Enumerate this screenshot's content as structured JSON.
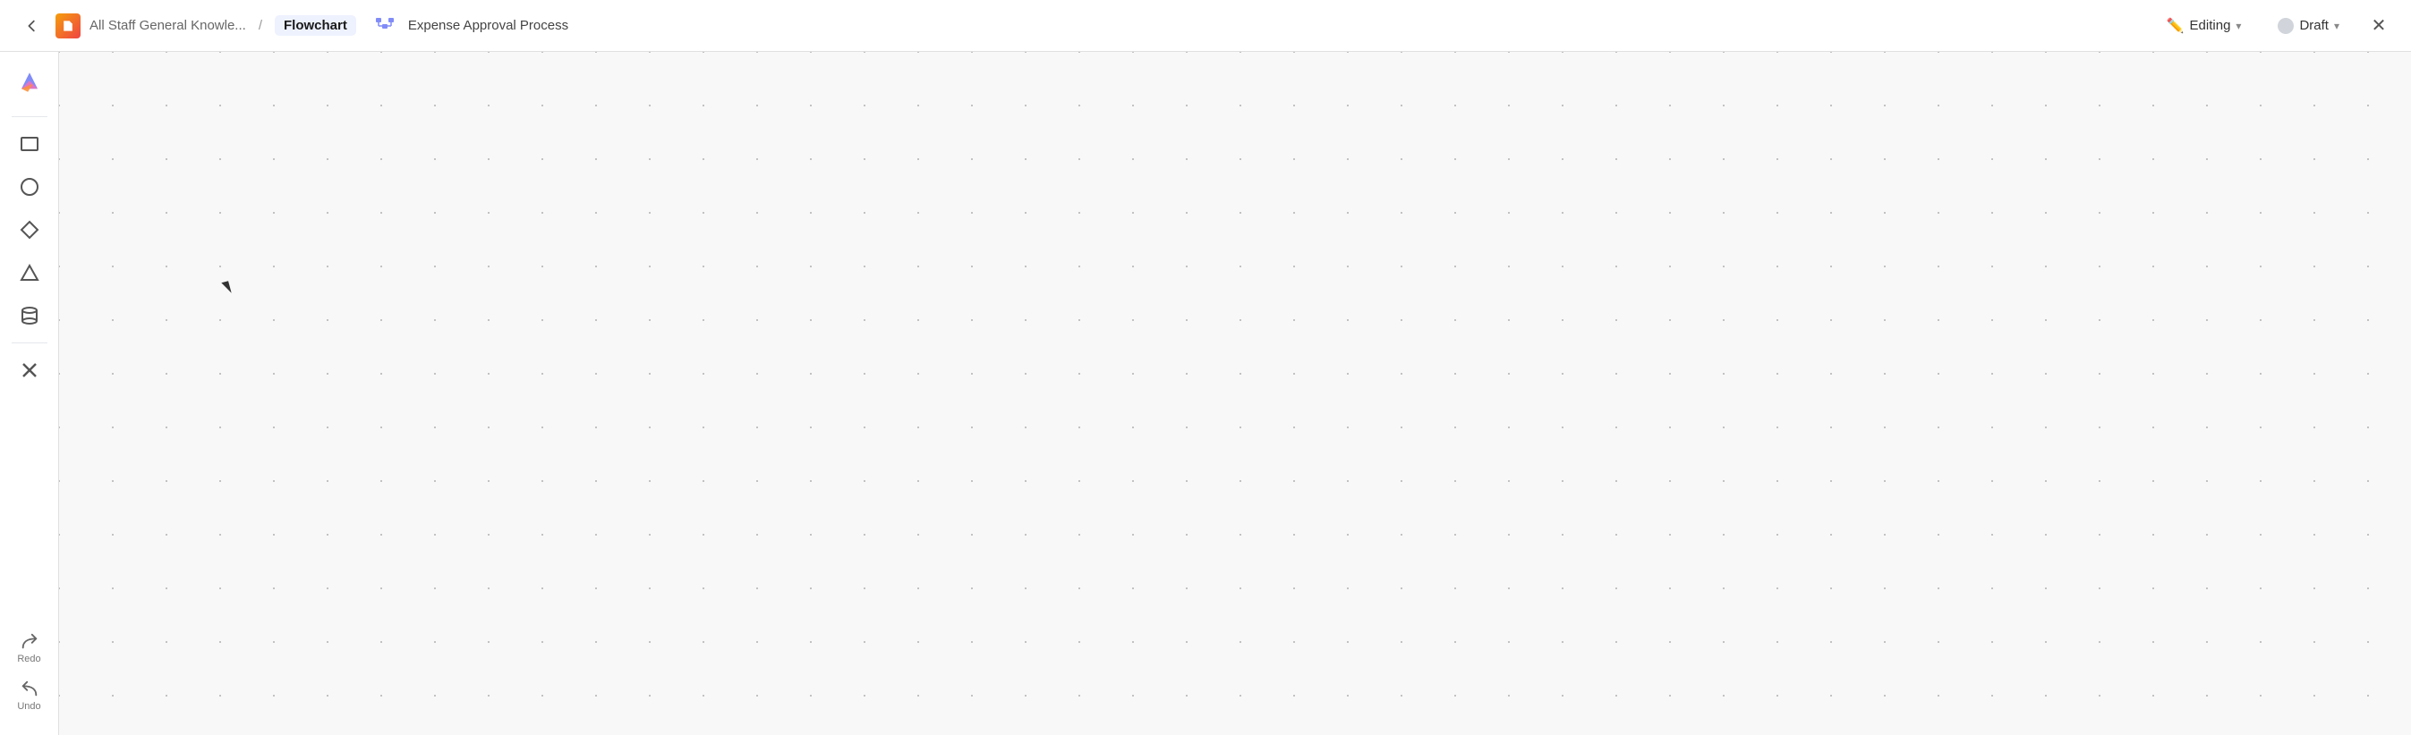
{
  "topbar": {
    "back_label": "←",
    "breadcrumb_parent": "All Staff General Knowle...",
    "breadcrumb_separator": "/",
    "breadcrumb_current": "Flowchart",
    "breadcrumb_title": "Expense Approval Process",
    "editing_label": "Editing",
    "draft_label": "Draft",
    "close_label": "✕"
  },
  "sidebar": {
    "logo_label": "🎨",
    "tools": [
      {
        "name": "rectangle-tool",
        "label": "Rectangle"
      },
      {
        "name": "circle-tool",
        "label": "Circle"
      },
      {
        "name": "diamond-tool",
        "label": "Diamond"
      },
      {
        "name": "triangle-tool",
        "label": "Triangle"
      },
      {
        "name": "cylinder-tool",
        "label": "Cylinder"
      },
      {
        "name": "delete-tool",
        "label": "Delete"
      }
    ],
    "redo_label": "Redo",
    "undo_label": "Undo"
  },
  "canvas": {
    "background": "#f8f8f8"
  }
}
